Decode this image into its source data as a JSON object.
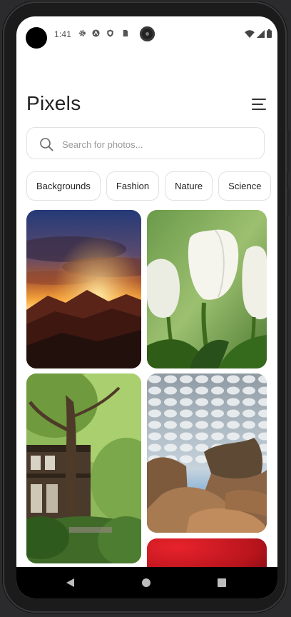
{
  "status_bar": {
    "time": "1:41",
    "left_icons": [
      "gear-icon",
      "android-auto-icon",
      "shield-icon",
      "sim-card-icon"
    ],
    "right_icons": [
      "wifi-icon",
      "cellular-signal-icon",
      "battery-icon"
    ]
  },
  "header": {
    "title": "Pixels",
    "menu_icon": "menu-icon"
  },
  "search": {
    "placeholder": "Search for photos...",
    "value": ""
  },
  "categories": [
    "Backgrounds",
    "Fashion",
    "Nature",
    "Science"
  ],
  "photos": [
    {
      "subject": "sunset-mountains",
      "column": 1
    },
    {
      "subject": "white-tulips",
      "column": 2
    },
    {
      "subject": "japanese-house-tree",
      "column": 1
    },
    {
      "subject": "rocks-cloudy-sky",
      "column": 2
    },
    {
      "subject": "red-gradient",
      "column": 2
    }
  ],
  "nav_bar": {
    "back_icon": "back-triangle-icon",
    "home_icon": "home-circle-icon",
    "recents_icon": "recents-square-icon"
  },
  "colors": {
    "background": "#ffffff",
    "text_primary": "#222222",
    "placeholder": "#9a9a9a",
    "border": "#e0e0e0",
    "nav_bar": "#000000"
  }
}
